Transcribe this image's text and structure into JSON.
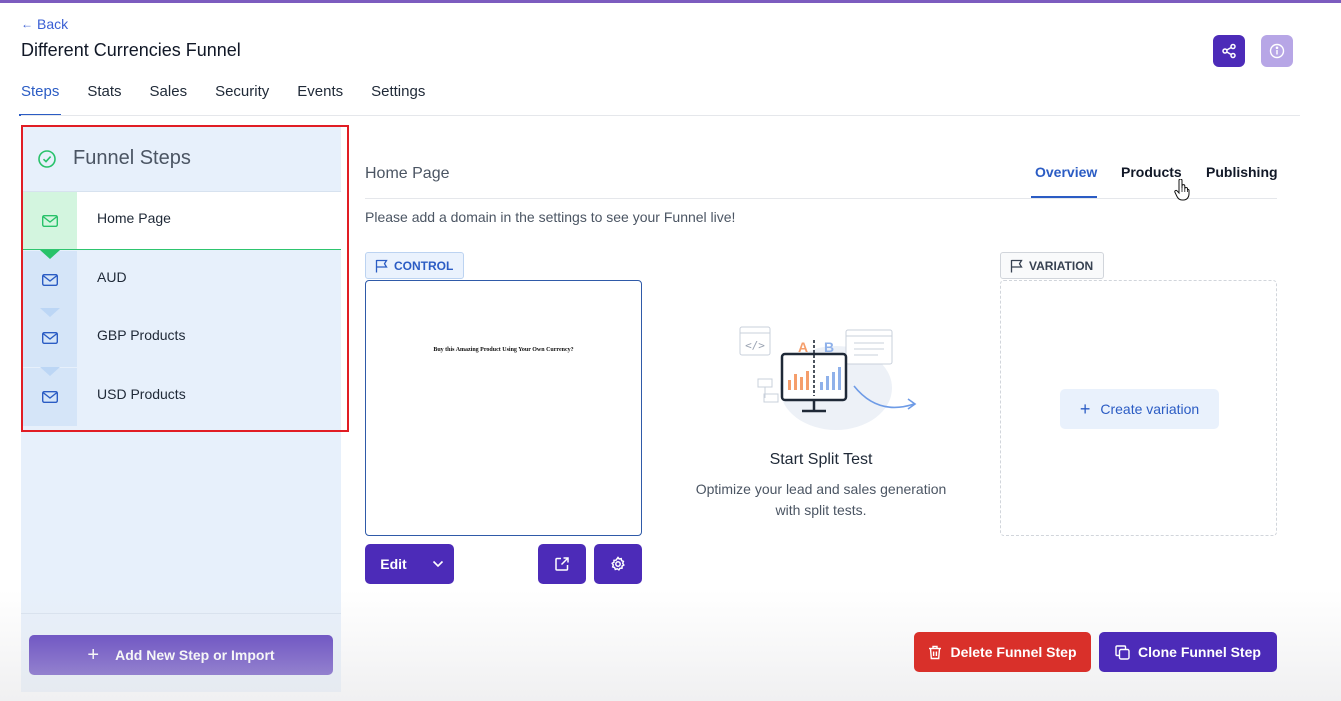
{
  "header": {
    "back_label": "Back",
    "title": "Different Currencies Funnel",
    "share_icon": "share-icon",
    "info_icon": "info-icon"
  },
  "tabs": [
    {
      "label": "Steps",
      "active": true
    },
    {
      "label": "Stats",
      "active": false
    },
    {
      "label": "Sales",
      "active": false
    },
    {
      "label": "Security",
      "active": false
    },
    {
      "label": "Events",
      "active": false
    },
    {
      "label": "Settings",
      "active": false
    }
  ],
  "sidebar": {
    "title": "Funnel Steps",
    "steps": [
      {
        "label": "Home Page",
        "active": true
      },
      {
        "label": "AUD",
        "active": false
      },
      {
        "label": "GBP Products",
        "active": false
      },
      {
        "label": "USD Products",
        "active": false
      }
    ],
    "add_button_label": "Add New Step or Import"
  },
  "main": {
    "step_name": "Home Page",
    "subtabs": [
      {
        "label": "Overview",
        "active": true
      },
      {
        "label": "Products",
        "active": false
      },
      {
        "label": "Publishing",
        "active": false
      }
    ],
    "domain_message": "Please add a domain in the settings to see your Funnel live!",
    "control_label": "CONTROL",
    "preview_text": "Buy this Amazing Product Using Your Own Currency?",
    "edit_label": "Edit",
    "split_test_title": "Start Split Test",
    "split_test_description": "Optimize your lead and sales generation with split tests.",
    "illustration_letters": [
      "A",
      "B"
    ],
    "variation_label": "VARIATION",
    "create_variation_label": "Create variation",
    "delete_label": "Delete Funnel Step",
    "clone_label": "Clone Funnel Step"
  },
  "colors": {
    "primary": "#4c2bb8",
    "link": "#2b5cc4",
    "danger": "#d9302a",
    "success": "#28c26a",
    "highlight": "#e11d24"
  }
}
